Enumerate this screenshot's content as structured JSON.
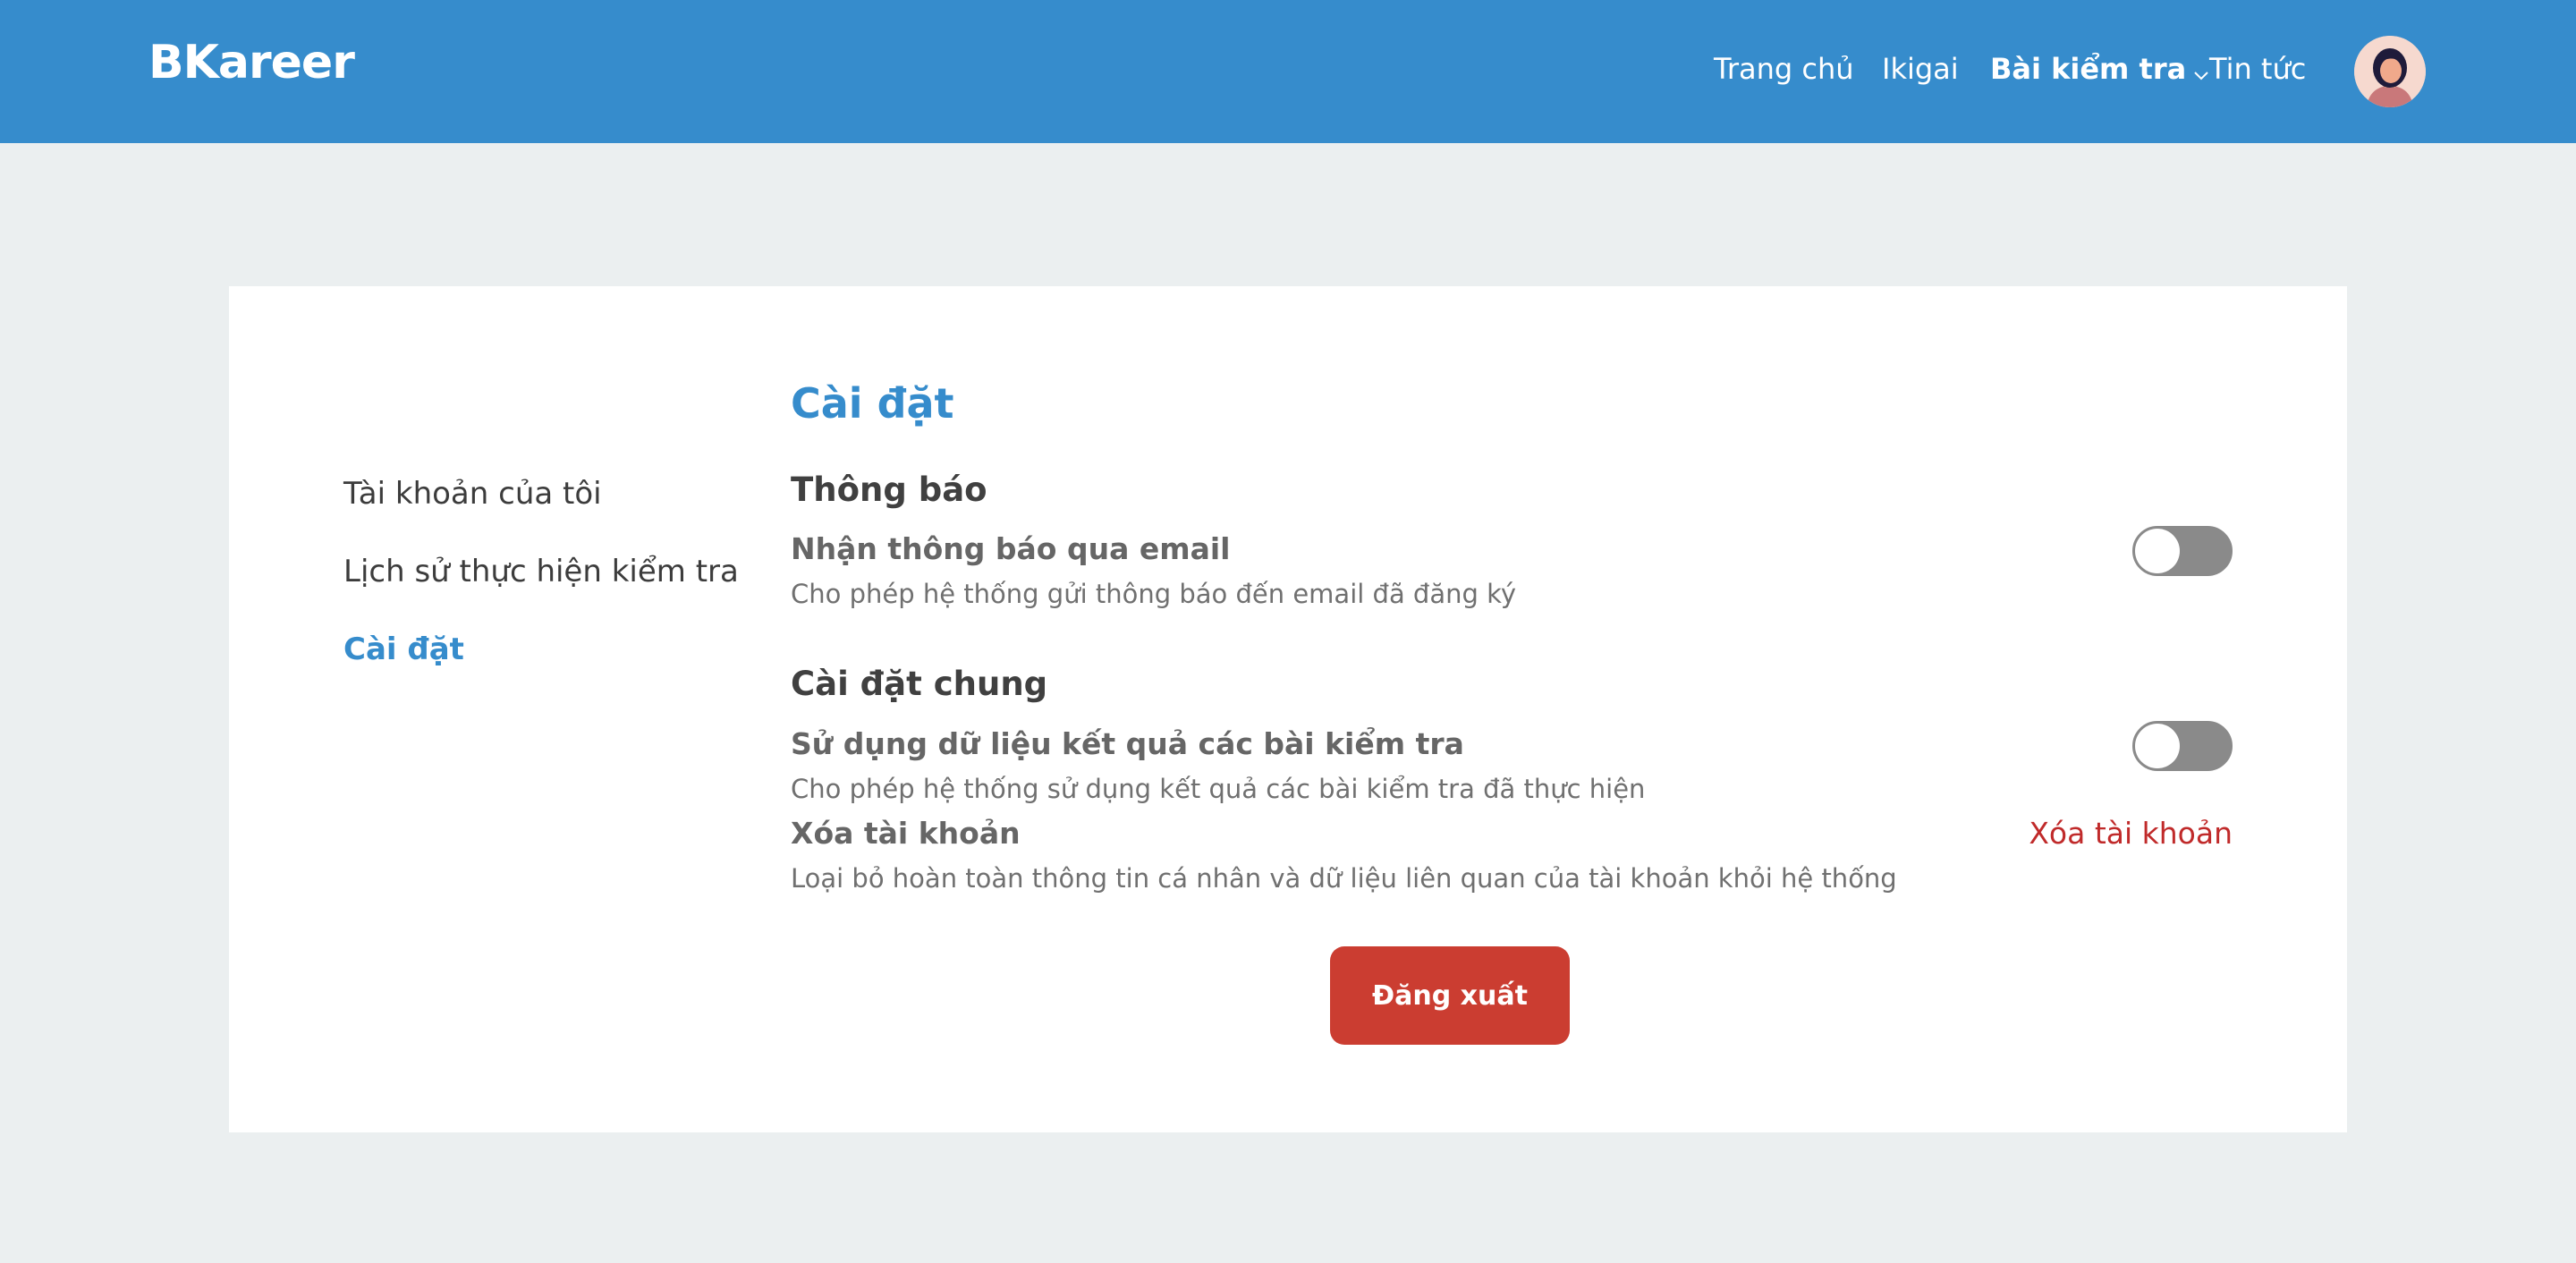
{
  "header": {
    "brand": "BKareer",
    "nav": {
      "home": "Trang chủ",
      "ikigai": "Ikigai",
      "tests": "Bài kiểm tra",
      "news": "Tin tức"
    },
    "colors": {
      "bar": "#368ccc"
    }
  },
  "sidebar": {
    "items": [
      {
        "label": "Tài khoản của tôi",
        "active": false
      },
      {
        "label": "Lịch sử thực hiện kiểm tra",
        "active": false
      },
      {
        "label": "Cài đặt",
        "active": true
      }
    ]
  },
  "settings": {
    "title": "Cài đặt",
    "notifications": {
      "heading": "Thông báo",
      "email": {
        "title": "Nhận thông báo qua email",
        "description": "Cho phép hệ thống gửi thông báo đến email đã đăng ký",
        "enabled": false
      }
    },
    "general": {
      "heading": "Cài đặt chung",
      "use_results": {
        "title": "Sử dụng dữ liệu kết quả các bài kiểm tra",
        "description": "Cho phép hệ thống sử dụng kết quả các bài kiểm tra đã thực hiện",
        "enabled": false
      },
      "delete_account": {
        "title": "Xóa tài khoản",
        "description": "Loại bỏ hoàn toàn thông tin cá nhân và dữ liệu liên quan của tài khoản khỏi hệ thống",
        "action_label": "Xóa tài khoản"
      }
    },
    "logout_label": "Đăng xuất"
  },
  "colors": {
    "accent": "#368ccc",
    "danger": "#c02a2a",
    "logout": "#cb3d31",
    "toggle_off": "#8a8a8a",
    "background": "#ebeff0"
  }
}
